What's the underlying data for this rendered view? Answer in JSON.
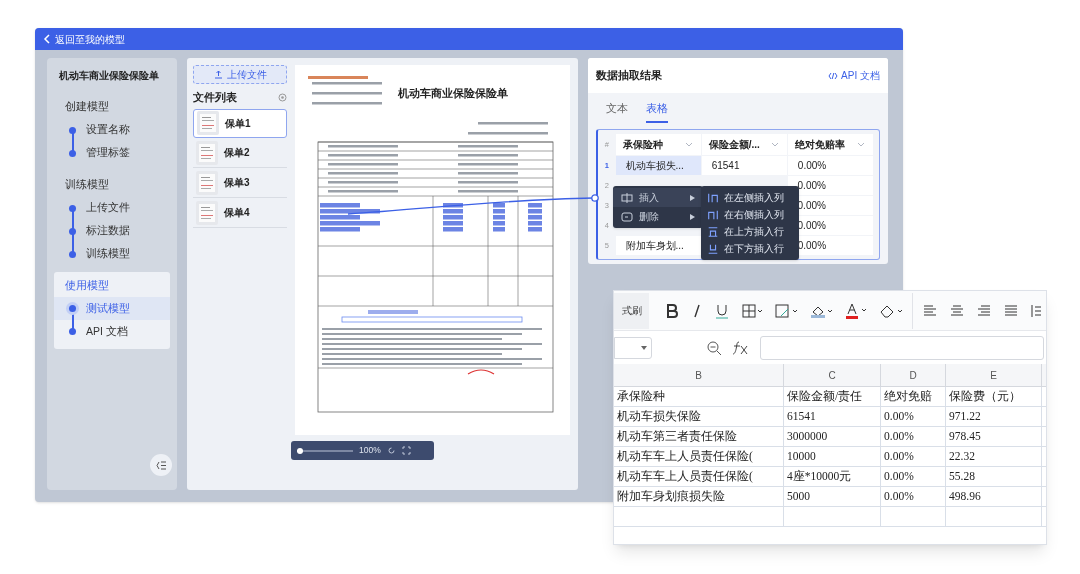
{
  "topbar": {
    "back_label": "返回至我的模型"
  },
  "sidebar": {
    "title": "机动车商业保险保险单",
    "groups": [
      {
        "label": "创建模型",
        "selected": false,
        "children": [
          {
            "label": "设置名称",
            "selected": false
          },
          {
            "label": "管理标签",
            "selected": false
          }
        ]
      },
      {
        "label": "训练模型",
        "selected": false,
        "children": [
          {
            "label": "上传文件",
            "selected": false
          },
          {
            "label": "标注数据",
            "selected": false
          },
          {
            "label": "训练模型",
            "selected": false
          }
        ]
      },
      {
        "label": "使用模型",
        "selected": true,
        "children": [
          {
            "label": "测试模型",
            "selected": true
          },
          {
            "label": "API 文档",
            "selected": false
          }
        ]
      }
    ]
  },
  "files": {
    "upload_label": "上传文件",
    "heading": "文件列表",
    "items": [
      {
        "name": "保单1",
        "selected": true
      },
      {
        "name": "保单2",
        "selected": false
      },
      {
        "name": "保单3",
        "selected": false
      },
      {
        "name": "保单4",
        "selected": false
      }
    ]
  },
  "document": {
    "title": "机动车商业保险保险单",
    "zoom": {
      "level": 0.05,
      "reading": "100%"
    }
  },
  "results": {
    "title": "数据抽取结果",
    "api_link": "API 文档",
    "tabs": [
      {
        "label": "文本",
        "selected": false
      },
      {
        "label": "表格",
        "selected": true
      }
    ],
    "table": {
      "index_header": "#",
      "columns": [
        "承保险种",
        "保险金额/...",
        "绝对免赔率"
      ],
      "rows": [
        {
          "index": "1",
          "cells": [
            "机动车损失...",
            "61541",
            "0.00%"
          ],
          "selected": true
        },
        {
          "index": "2",
          "cells": [
            "",
            "",
            "0.00%"
          ],
          "selected": false
        },
        {
          "index": "3",
          "cells": [
            "",
            "",
            "0.00%"
          ],
          "selected": false
        },
        {
          "index": "4",
          "cells": [
            "",
            "",
            "0.00%"
          ],
          "selected": false
        },
        {
          "index": "5",
          "cells": [
            "附加车身划...",
            "",
            "0.00%"
          ],
          "selected": false
        }
      ]
    }
  },
  "context_menu": {
    "items": [
      {
        "label": "插入",
        "kind": "insert",
        "selected": true
      },
      {
        "label": "删除",
        "kind": "delete",
        "selected": false
      }
    ],
    "submenu": [
      {
        "label": "在左侧插入列",
        "kind": "col-left"
      },
      {
        "label": "在右侧插入列",
        "kind": "col-right"
      },
      {
        "label": "在上方插入行",
        "kind": "row-above"
      },
      {
        "label": "在下方插入行",
        "kind": "row-below"
      }
    ]
  },
  "spreadsheet": {
    "format_painter": "式刷",
    "columns": [
      "B",
      "C",
      "D",
      "E"
    ],
    "rows": [
      [
        "承保险种",
        "保险金额/责任",
        "绝对免赔",
        "保险费（元）"
      ],
      [
        "机动车损失保险",
        "61541",
        "0.00%",
        "971.22"
      ],
      [
        "机动车第三者责任保险",
        "3000000",
        "0.00%",
        "978.45"
      ],
      [
        "机动车车上人员责任保险(",
        "10000",
        "0.00%",
        "22.32"
      ],
      [
        "机动车车上人员责任保险(",
        "4座*10000元",
        "0.00%",
        "55.28"
      ],
      [
        "附加车身划痕损失险",
        "5000",
        "0.00%",
        "498.96"
      ]
    ]
  }
}
